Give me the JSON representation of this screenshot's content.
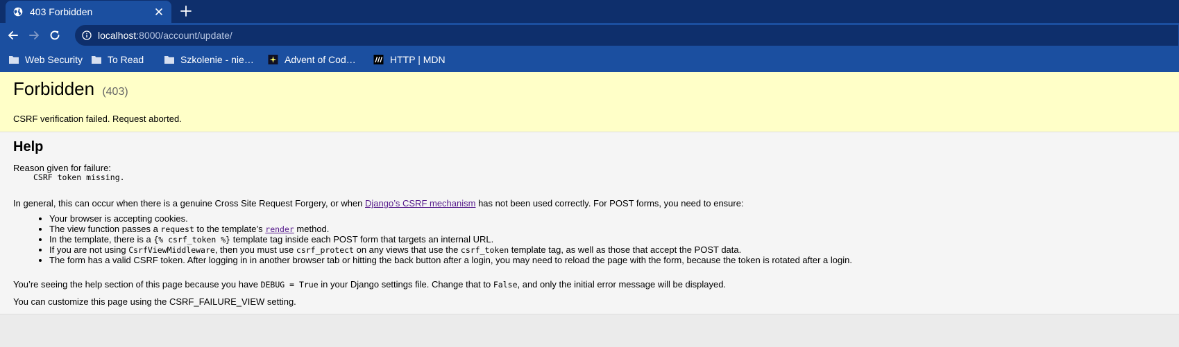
{
  "browser": {
    "tab": {
      "title": "403 Forbidden",
      "favicon": "globe-icon"
    },
    "address": {
      "host": "localhost",
      "path": ":8000/account/update/"
    },
    "bookmarks": [
      {
        "label": "Web Security",
        "icon": "folder-icon"
      },
      {
        "label": "To Read",
        "icon": "folder-icon"
      },
      {
        "label": "Szkolenie - nie…",
        "icon": "folder-icon"
      },
      {
        "label": "Advent of Cod…",
        "icon": "advent-star-icon"
      },
      {
        "label": "HTTP | MDN",
        "icon": "mdn-icon"
      }
    ]
  },
  "summary": {
    "title": "Forbidden",
    "code": "(403)",
    "message": "CSRF verification failed. Request aborted."
  },
  "help": {
    "heading": "Help",
    "reason_label": "Reason given for failure:",
    "reason_value": "CSRF token missing.",
    "general_pre": "In general, this can occur when there is a genuine Cross Site Request Forgery, or when ",
    "general_link": "Django’s CSRF mechanism",
    "general_post": " has not been used correctly. For POST forms, you need to ensure:",
    "items": {
      "i1": "Your browser is accepting cookies.",
      "i2_pre": "The view function passes a ",
      "i2_code": "request",
      "i2_mid": " to the template’s ",
      "i2_link": "render",
      "i2_post": " method.",
      "i3_pre": "In the template, there is a ",
      "i3_code": "{% csrf_token %}",
      "i3_post": " template tag inside each POST form that targets an internal URL.",
      "i4_pre": "If you are not using ",
      "i4_code1": "CsrfViewMiddleware",
      "i4_mid1": ", then you must use ",
      "i4_code2": "csrf_protect",
      "i4_mid2": " on any views that use the ",
      "i4_code3": "csrf_token",
      "i4_post": " template tag, as well as those that accept the POST data.",
      "i5": "The form has a valid CSRF token. After logging in in another browser tab or hitting the back button after a login, you may need to reload the page with the form, because the token is rotated after a login."
    },
    "debug_pre": "You’re seeing the help section of this page because you have ",
    "debug_code": "DEBUG = True",
    "debug_mid": " in your Django settings file. Change that to ",
    "debug_code2": "False",
    "debug_post": ", and only the initial error message will be displayed.",
    "customize": "You can customize this page using the CSRF_FAILURE_VIEW setting."
  },
  "colors": {
    "tabstrip": "#0e2f6c",
    "toolbar": "#1b4fa0",
    "summary_bg": "#ffffc8",
    "explanation_bg": "#f5f5f5",
    "link": "#551a8b"
  }
}
